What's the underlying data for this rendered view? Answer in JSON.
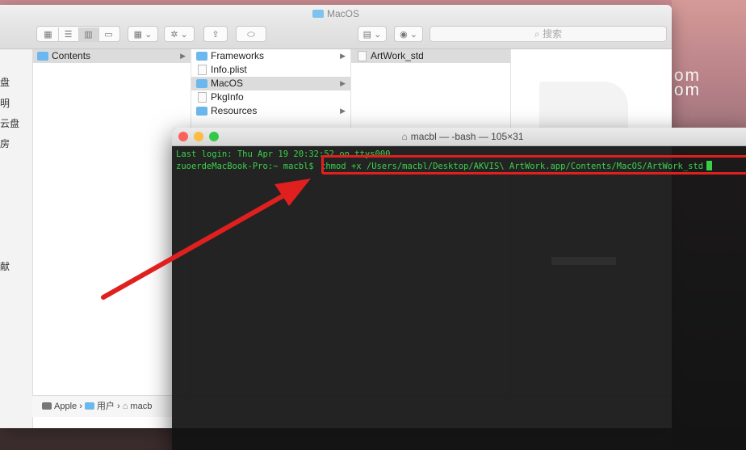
{
  "watermark": {
    "line1": "om",
    "line2": "Macv.com"
  },
  "finder": {
    "title": "MacOS",
    "search_placeholder": "搜索",
    "sidebar_fragments": [
      "盘",
      "明",
      "云盘",
      "房",
      "献"
    ],
    "columns": [
      {
        "items": [
          {
            "label": "Contents",
            "type": "folder",
            "selected": true,
            "arrow": true
          }
        ]
      },
      {
        "items": [
          {
            "label": "Frameworks",
            "type": "folder",
            "arrow": true
          },
          {
            "label": "Info.plist",
            "type": "doc"
          },
          {
            "label": "MacOS",
            "type": "folder",
            "selected": true,
            "arrow": true
          },
          {
            "label": "PkgInfo",
            "type": "doc"
          },
          {
            "label": "Resources",
            "type": "folder",
            "arrow": true
          }
        ]
      },
      {
        "items": [
          {
            "label": "ArtWork_std",
            "type": "doc",
            "selected": true
          }
        ]
      }
    ],
    "path": {
      "seg1": "Apple",
      "seg2": "用户",
      "seg3": "macb"
    }
  },
  "terminal": {
    "title": "macbl — -bash — 105×31",
    "last_login": "Last login: Thu Apr 19 20:32:52 on ttys000",
    "prompt": "zuoerdeMacBook-Pro:~ macbl$",
    "command": "chmod +x /Users/macbl/Desktop/AKVIS\\ ArtWork.app/Contents/MacOS/ArtWork_std"
  },
  "colors": {
    "accent_red": "#e0201f",
    "term_green": "#39d34a",
    "folder_blue": "#6cb8ee"
  }
}
